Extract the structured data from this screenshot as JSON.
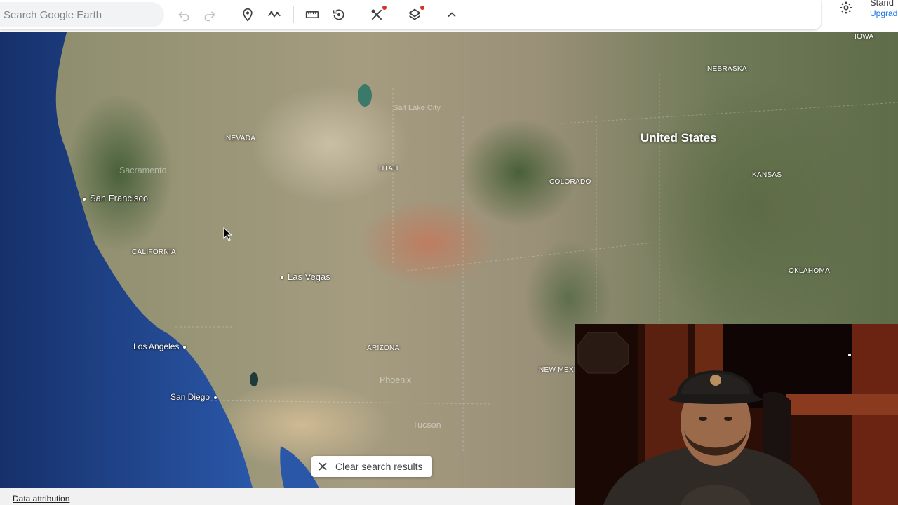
{
  "toolbar": {
    "search_placeholder": "Search Google Earth",
    "icons": [
      "undo-icon",
      "redo-icon",
      "add-placemark-icon",
      "add-path-icon",
      "measure-icon",
      "historical-imagery-icon",
      "tools-icon",
      "map-style-icon",
      "collapse-icon"
    ],
    "alert_color": "#d93025"
  },
  "account": {
    "plan": "Stand",
    "upgrade": "Upgrad"
  },
  "map": {
    "country": "United States",
    "states": [
      "NEVADA",
      "UTAH",
      "COLORADO",
      "NEBRASKA",
      "KANSAS",
      "CALIFORNIA",
      "ARIZONA",
      "OKLAHOMA",
      "IOWA",
      "NEW MEXIC"
    ],
    "cities": [
      "San Francisco",
      "Las Vegas",
      "Los Angeles",
      "San Diego"
    ],
    "faded_labels": [
      "Sacramento",
      "Salt Lake City",
      "Phoenix",
      "Tucson"
    ]
  },
  "chip": {
    "clear_label": "Clear search results"
  },
  "footer": {
    "attribution": "Data attribution"
  },
  "colors": {
    "ocean": "#1d3c7a",
    "accent": "#1a73e8"
  }
}
